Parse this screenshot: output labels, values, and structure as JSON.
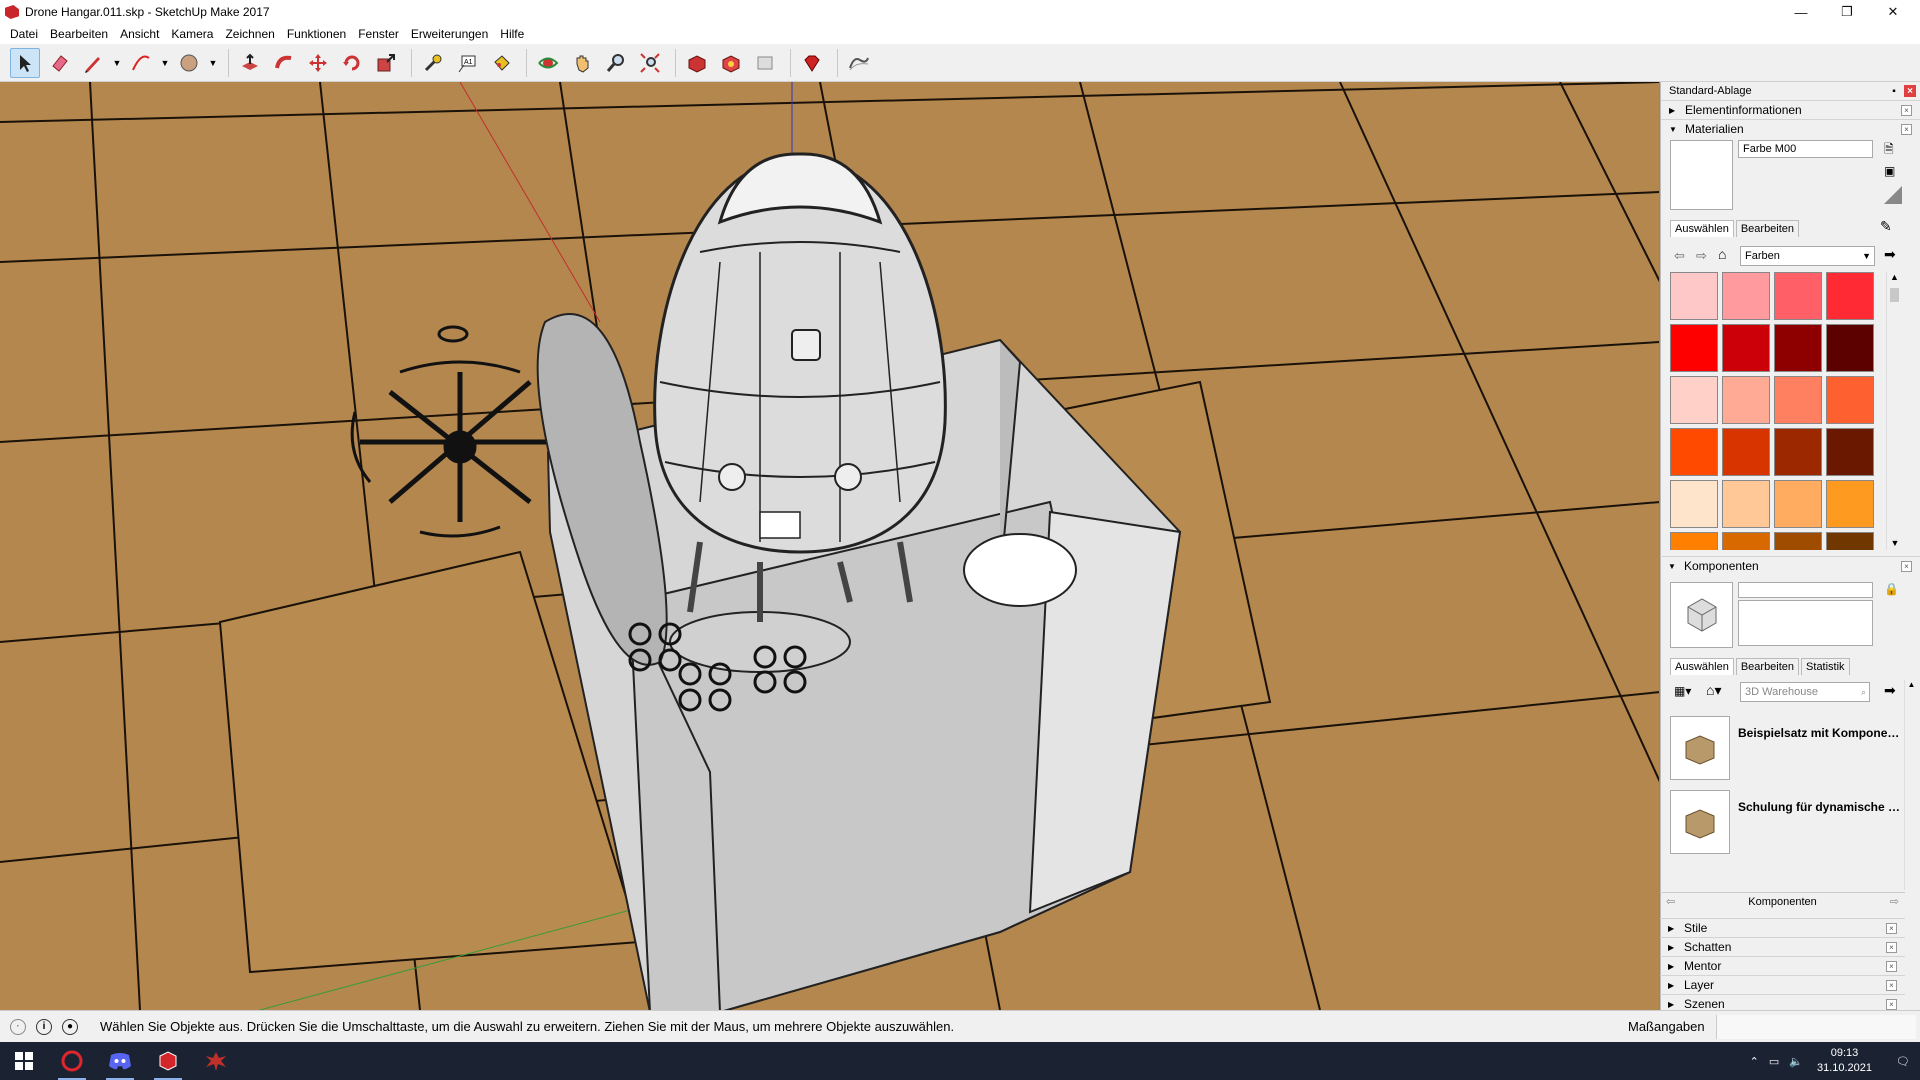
{
  "window": {
    "title": "Drone Hangar.011.skp - SketchUp Make 2017",
    "minimize": "—",
    "maximize": "❐",
    "close": "✕"
  },
  "menu": [
    "Datei",
    "Bearbeiten",
    "Ansicht",
    "Kamera",
    "Zeichnen",
    "Funktionen",
    "Fenster",
    "Erweiterungen",
    "Hilfe"
  ],
  "toolbar": {
    "tools": [
      "select-icon",
      "eraser-icon",
      "pencil-icon",
      "arc-icon",
      "shape-icon",
      "push-pull-icon",
      "follow-me-icon",
      "move-icon",
      "rotate-icon",
      "scale-icon",
      "tape-measure-icon",
      "text-icon",
      "paint-bucket-icon",
      "orbit-icon",
      "pan-icon",
      "zoom-icon",
      "zoom-extents-icon",
      "warehouse-icon",
      "extension-warehouse-icon",
      "layout-icon",
      "ruby-icon",
      "sandbox-icon"
    ]
  },
  "tray": {
    "title": "Standard-Ablage",
    "sections": {
      "entity_info": "Elementinformationen",
      "materials": "Materialien",
      "components": "Komponenten"
    },
    "materials": {
      "name": "Farbe M00",
      "tab_select": "Auswählen",
      "tab_edit": "Bearbeiten",
      "library": "Farben",
      "swatches": [
        "#ffc8c8",
        "#ff9a9e",
        "#ff6068",
        "#ff2a34",
        "#ff0000",
        "#cc0008",
        "#8e0000",
        "#5c0000",
        "#ffd0c8",
        "#ffaa94",
        "#ff8060",
        "#ff6030",
        "#ff4a00",
        "#d83400",
        "#9c2800",
        "#6a1800",
        "#ffe4cc",
        "#ffc896",
        "#ffac60",
        "#ff9a20",
        "#ff8000",
        "#d86800",
        "#a04c00",
        "#703800"
      ]
    },
    "components": {
      "tab_select": "Auswählen",
      "tab_edit": "Bearbeiten",
      "tab_stats": "Statistik",
      "search_placeholder": "3D Warehouse",
      "items": [
        "Beispielsatz mit Kompone…",
        "Schulung für dynamische …"
      ],
      "footer": "Komponenten"
    },
    "collapsed": [
      "Stile",
      "Schatten",
      "Mentor",
      "Layer",
      "Szenen"
    ]
  },
  "status": {
    "message": "Wählen Sie Objekte aus. Drücken Sie die Umschalttaste, um die Auswahl zu erweitern. Ziehen Sie mit der Maus, um mehrere Objekte auszuwählen.",
    "measurements_label": "Maßangaben"
  },
  "taskbar": {
    "time": "09:13",
    "date": "31.10.2021"
  }
}
